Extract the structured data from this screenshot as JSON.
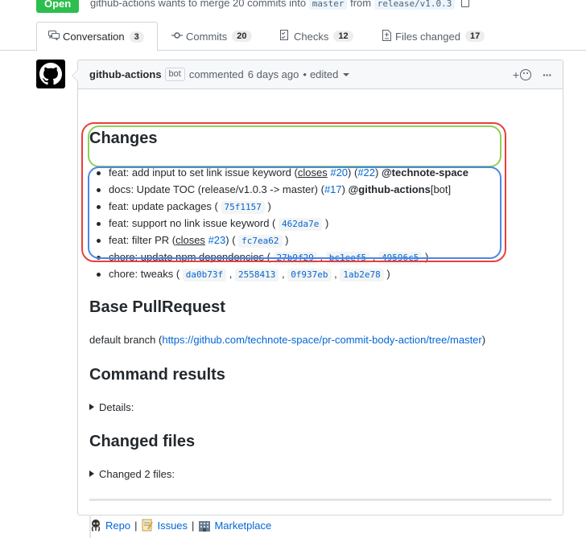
{
  "pr": {
    "state": "Open",
    "merge_text": "github-actions wants to merge 20 commits into",
    "base_branch": "master",
    "from_word": "from",
    "head_branch": "release/v1.0.3"
  },
  "tabs": [
    {
      "label": "Conversation",
      "count": "3",
      "icon": "conversation-icon"
    },
    {
      "label": "Commits",
      "count": "20",
      "icon": "commit-icon"
    },
    {
      "label": "Checks",
      "count": "12",
      "icon": "checklist-icon"
    },
    {
      "label": "Files changed",
      "count": "17",
      "icon": "file-diff-icon"
    }
  ],
  "comment": {
    "author": "github-actions",
    "bot_label": "bot",
    "action": "commented",
    "time": "6 days ago",
    "separator": "•",
    "edited": "edited",
    "react_plus": "+",
    "more": "···",
    "changes_title": "Changes",
    "changes": [
      {
        "prefix": "feat: add input to set link issue keyword (",
        "closes": "closes",
        "issue": "#20",
        "mid": ") (",
        "pr": "#22",
        "close": ") ",
        "mention": "@technote-space"
      },
      {
        "prefix": "docs: Update TOC (release/v1.0.3 -> master) (",
        "pr": "#17",
        "close": ") ",
        "mention": "@github-actions",
        "suffix": "[bot]"
      },
      {
        "prefix": "feat: update packages (",
        "shas": [
          "75f1157"
        ],
        "close": ")"
      },
      {
        "prefix": "feat: support no link issue keyword (",
        "shas": [
          "462da7e"
        ],
        "close": ")"
      },
      {
        "prefix": "feat: filter PR (",
        "closes": "closes",
        "issue": "#23",
        "mid": ") (",
        "shas": [
          "fc7ea62"
        ],
        "close": ")"
      },
      {
        "prefix": "chore: update npm dependencies (",
        "shas": [
          "27b9f29",
          "bc1eef5",
          "49596c5"
        ],
        "close": ")"
      },
      {
        "prefix": "chore: tweaks (",
        "shas": [
          "da0b73f",
          "2558413",
          "0f937eb",
          "1ab2e78"
        ],
        "close": ")"
      }
    ],
    "base_title": "Base PullRequest",
    "base_prefix": "default branch (",
    "base_link": "https://github.com/technote-space/pr-commit-body-action/tree/master",
    "base_suffix": ")",
    "command_title": "Command results",
    "details_label": "Details:",
    "files_title": "Changed files",
    "files_label": "Changed 2 files:",
    "footer": [
      {
        "label": "Repo",
        "icon": "octocat-icon"
      },
      {
        "label": "Issues",
        "icon": "memo-icon"
      },
      {
        "label": "Marketplace",
        "icon": "building-icon"
      }
    ],
    "footer_sep": "|"
  },
  "colors": {
    "open_green": "#2cbe4e",
    "link_blue": "#0366d6",
    "mark_red": "#e8403a",
    "mark_green": "#8fd05a",
    "mark_blue": "#4d86e8"
  }
}
